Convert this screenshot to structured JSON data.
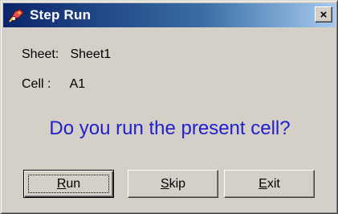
{
  "window": {
    "title": "Step Run",
    "icon": "step-run-app-icon",
    "close_label": "×"
  },
  "info": {
    "sheet_label": "Sheet:",
    "sheet_value": "Sheet1",
    "cell_label": "Cell :",
    "cell_value": "A1"
  },
  "message": {
    "question": "Do you run the present cell?",
    "color": "#1f1fcf"
  },
  "buttons": {
    "run": {
      "mnemonic": "R",
      "rest": "un"
    },
    "skip": {
      "mnemonic": "S",
      "rest": "kip"
    },
    "exit": {
      "mnemonic": "E",
      "rest": "xit"
    }
  },
  "colors": {
    "titlebar_start": "#0a246a",
    "titlebar_end": "#a6caf0",
    "dialog_face": "#d4d0c8"
  }
}
